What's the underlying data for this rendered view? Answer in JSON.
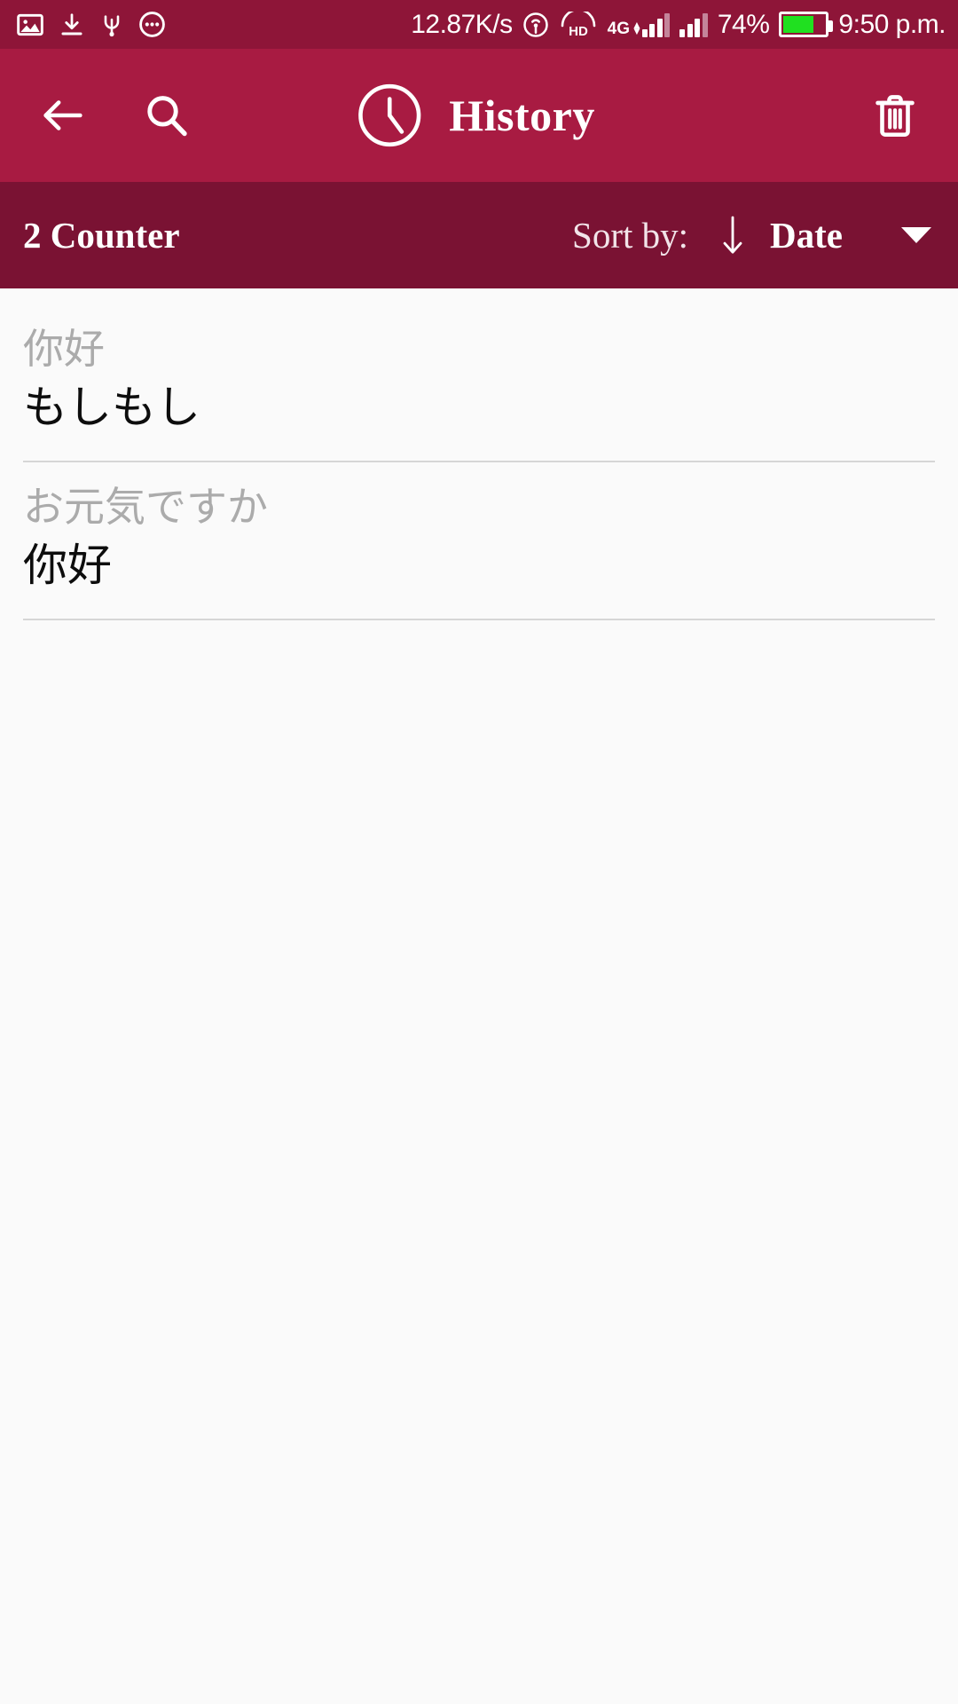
{
  "status_bar": {
    "left_icons": [
      "image-icon",
      "download-icon",
      "usb-icon",
      "more-options-icon"
    ],
    "network_speed": "12.87K/s",
    "hotspot_icon": "hotspot-icon",
    "hd_label": "HD",
    "network_type": "4G",
    "battery_percent": "74%",
    "battery_level": 74,
    "battery_color": "#20E020",
    "time": "9:50 p.m."
  },
  "app_bar": {
    "back_icon": "back-arrow-icon",
    "search_icon": "search-icon",
    "clock_icon": "clock-icon",
    "title": "History",
    "delete_icon": "trash-icon",
    "background_color": "#A81B42"
  },
  "sort_bar": {
    "counter_label": "2 Counter",
    "sort_by_label": "Sort by:",
    "direction_icon": "arrow-down-icon",
    "sort_value": "Date",
    "dropdown_icon": "caret-down-icon",
    "background_color": "#7A1233"
  },
  "history": {
    "items": [
      {
        "source": "你好",
        "target": "もしもし"
      },
      {
        "source": "お元気ですか",
        "target": "你好"
      }
    ]
  }
}
